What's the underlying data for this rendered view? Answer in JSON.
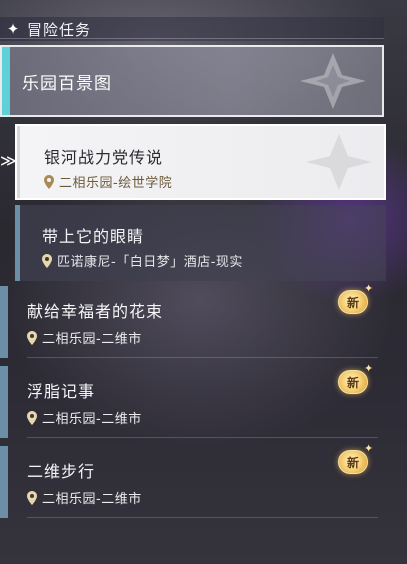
{
  "header": {
    "title": "冒险任务",
    "icon": "diamond-star-icon"
  },
  "category": {
    "label": "乐园百景图"
  },
  "sub_items": [
    {
      "title": "银河战力党传说",
      "location": "二相乐园-绘世学院",
      "selected": true
    },
    {
      "title": "带上它的眼睛",
      "location": "匹诺康尼-「白日梦」酒店-现实",
      "selected": false
    }
  ],
  "quests": [
    {
      "title": "献给幸福者的花束",
      "location": "二相乐园-二维市",
      "badge": "新"
    },
    {
      "title": "浮脂记事",
      "location": "二相乐园-二维市",
      "badge": "新"
    },
    {
      "title": "二维步行",
      "location": "二相乐园-二维市",
      "badge": "新"
    }
  ],
  "colors": {
    "accent_teal": "#5fd1d6",
    "accent_steel": "#6a8fa6",
    "badge_gold": "#f6d27a"
  }
}
